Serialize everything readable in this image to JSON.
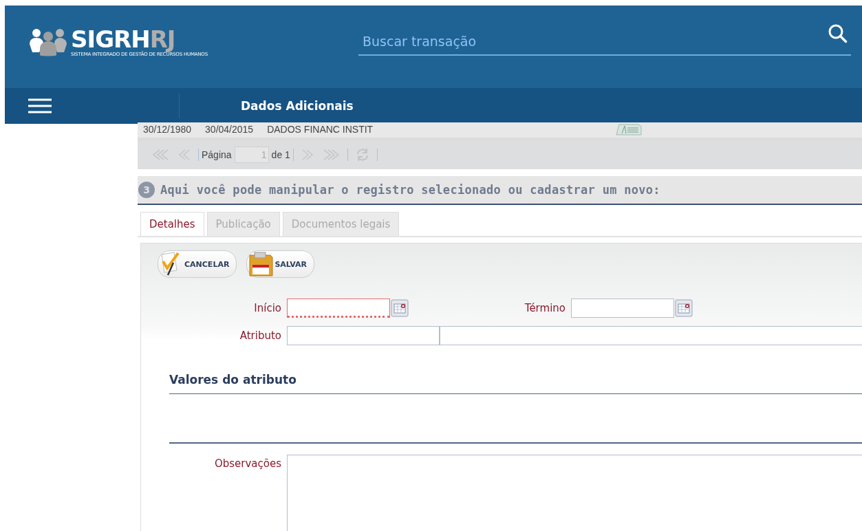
{
  "header": {
    "logo": {
      "main": "SIGRH",
      "accent": "RJ",
      "subtitle": "SISTEMA INTEGRADO DE GESTÃO DE RECURSOS HUMANOS"
    },
    "search": {
      "placeholder": "Buscar transação"
    }
  },
  "nav": {
    "title": "Dados Adicionais"
  },
  "grid": {
    "rows": [
      {
        "cells": [
          "30/12/1980",
          "30/04/2015",
          "DADOS FINANC INSTIT"
        ]
      }
    ]
  },
  "pager": {
    "page_label": "Página",
    "page": "1",
    "of_label": "de 1"
  },
  "section": {
    "number": "3",
    "text": "Aqui você pode manipular o registro selecionado ou cadastrar um novo:"
  },
  "tabs": [
    {
      "label": "Detalhes",
      "selected": true
    },
    {
      "label": "Publicação",
      "selected": false
    },
    {
      "label": "Documentos legais",
      "selected": false
    }
  ],
  "toolbar": [
    {
      "kind": "cancel",
      "label": "CANCELAR"
    },
    {
      "kind": "save",
      "label": "SALVAR"
    }
  ],
  "form": {
    "start": {
      "label": "Início",
      "invalid": true
    },
    "end": {
      "label": "Término",
      "invalid": false
    },
    "attribute": {
      "label": "Atributo"
    },
    "values_title": "Valores do atributo",
    "notes": {
      "label": "Observações"
    }
  }
}
